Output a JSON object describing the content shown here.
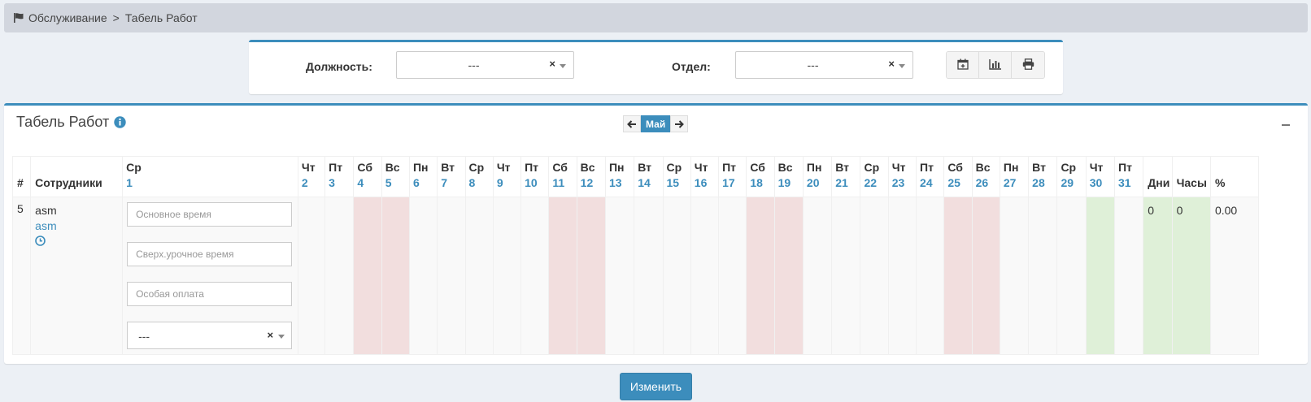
{
  "breadcrumb": {
    "item1": "Обслуживание",
    "separator": ">",
    "item2": "Табель Работ"
  },
  "filters": {
    "position_label": "Должность:",
    "position_value": "---",
    "department_label": "Отдел:",
    "department_value": "---",
    "clear_glyph": "×",
    "buttons": [
      "calendar-plus-icon",
      "bar-chart-icon",
      "print-icon"
    ]
  },
  "timesheet": {
    "title": "Табель Работ",
    "month": "Май",
    "columns": {
      "index": "#",
      "employees": "Сотрудники",
      "days_total": "Дни",
      "hours_total": "Часы",
      "percent": "%"
    },
    "days": [
      {
        "wd": "Ср",
        "d": "1"
      },
      {
        "wd": "Чт",
        "d": "2"
      },
      {
        "wd": "Пт",
        "d": "3"
      },
      {
        "wd": "Сб",
        "d": "4"
      },
      {
        "wd": "Вс",
        "d": "5"
      },
      {
        "wd": "Пн",
        "d": "6"
      },
      {
        "wd": "Вт",
        "d": "7"
      },
      {
        "wd": "Ср",
        "d": "8"
      },
      {
        "wd": "Чт",
        "d": "9"
      },
      {
        "wd": "Пт",
        "d": "10"
      },
      {
        "wd": "Сб",
        "d": "11"
      },
      {
        "wd": "Вс",
        "d": "12"
      },
      {
        "wd": "Пн",
        "d": "13"
      },
      {
        "wd": "Вт",
        "d": "14"
      },
      {
        "wd": "Ср",
        "d": "15"
      },
      {
        "wd": "Чт",
        "d": "16"
      },
      {
        "wd": "Пт",
        "d": "17"
      },
      {
        "wd": "Сб",
        "d": "18"
      },
      {
        "wd": "Вс",
        "d": "19"
      },
      {
        "wd": "Пн",
        "d": "20"
      },
      {
        "wd": "Вт",
        "d": "21"
      },
      {
        "wd": "Ср",
        "d": "22"
      },
      {
        "wd": "Чт",
        "d": "23"
      },
      {
        "wd": "Пт",
        "d": "24"
      },
      {
        "wd": "Сб",
        "d": "25"
      },
      {
        "wd": "Вс",
        "d": "26"
      },
      {
        "wd": "Пн",
        "d": "27"
      },
      {
        "wd": "Вт",
        "d": "28"
      },
      {
        "wd": "Ср",
        "d": "29"
      },
      {
        "wd": "Чт",
        "d": "30"
      },
      {
        "wd": "Пт",
        "d": "31"
      }
    ],
    "row": {
      "index": "5",
      "name": "asm",
      "login": "asm",
      "regular_time_placeholder": "Основное время",
      "overtime_placeholder": "Сверх.урочное время",
      "special_pay_placeholder": "Особая оплата",
      "select_value": "---",
      "days": "0",
      "hours": "0",
      "percent": "0.00"
    }
  },
  "submit_label": "Изменить",
  "colors": {
    "accent": "#3c8dbc",
    "weekend": "#f2dede",
    "holiday": "#dff0d8"
  }
}
